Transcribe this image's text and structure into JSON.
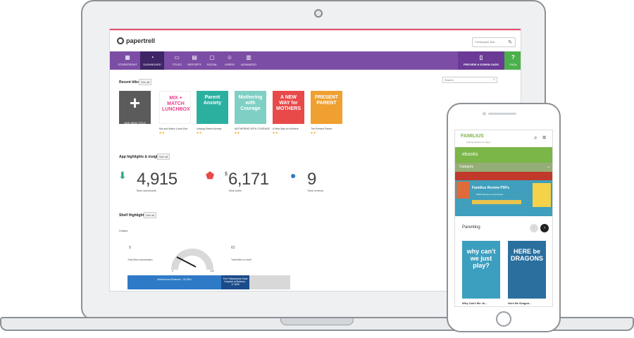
{
  "app": {
    "logo_text": "papertrell",
    "user_name": "Christopher Bat...",
    "attach_icon": "paperclip-icon"
  },
  "nav": {
    "items": [
      {
        "label": "STOREFRONT",
        "icon": "store-icon"
      },
      {
        "label": "DASHBOARD",
        "icon": "dashboard-icon",
        "active": true
      },
      {
        "label": "TITLES",
        "icon": "book-icon"
      },
      {
        "label": "REPORTS",
        "icon": "report-icon"
      },
      {
        "label": "SOCIAL",
        "icon": "chat-icon"
      },
      {
        "label": "USERS",
        "icon": "users-icon"
      },
      {
        "label": "ADVANCED",
        "icon": "settings-icon"
      }
    ],
    "preview_label": "PREVIEW & DOWNLOADS",
    "help_label": "FAQs",
    "help_icon": "?"
  },
  "recent": {
    "heading": "Recent titles",
    "see_all": "See all",
    "search_placeholder": "Search",
    "add_label": "ADD NEW TITLE",
    "books": [
      {
        "title": "MIX + MATCH LUNCHBOX",
        "caption": "Mix and Match Lunch Box",
        "color": "#ffffff",
        "text_color": "#e83e8c"
      },
      {
        "title": "Parent Anxiety",
        "caption": "Untying Parent Anxiety",
        "color": "#2bb0a0",
        "text_color": "#ffffff"
      },
      {
        "title": "Mothering with Courage",
        "caption": "MOTHERING WITH COURAGE",
        "color": "#7fcfc4",
        "text_color": "#ffffff"
      },
      {
        "title": "A NEW WAY for MOTHERS",
        "caption": "A New Way for Mothers",
        "color": "#e84a4a",
        "text_color": "#ffffff"
      },
      {
        "title": "PRESENT PARENT",
        "caption": "The Present Parent",
        "color": "#f0a030",
        "text_color": "#ffffff"
      }
    ]
  },
  "insights": {
    "heading": "App highlights & insights",
    "see_all": "See all",
    "stats": [
      {
        "value": "4,915",
        "label": "Total downloads",
        "icon": "download-icon",
        "color": "#2ea58a"
      },
      {
        "value": "6,171",
        "label": "Total sales",
        "icon": "price-tag-icon",
        "color": "#e84a4a",
        "currency": "$"
      },
      {
        "value": "9",
        "label": "Total reviews",
        "icon": "chat-bubbles-icon",
        "color": "#2e7ac7"
      }
    ]
  },
  "shelf": {
    "heading": "Shelf Highlights",
    "see_all": "See all",
    "panel_title": "Costco",
    "left_value": "9",
    "left_label": "Total titles downloaded",
    "right_value": "62",
    "right_label": "Total titles on shelf",
    "gauge_min": "0",
    "gauge_max": "100",
    "bar_blue_label": "Motherhood Realized - 33.28%",
    "bar_navy_label": "The Philadelphia State Hospital at Byberry - 17.85%"
  },
  "phone": {
    "brand": "FAMILIUS",
    "tagline": "Helping families be happy",
    "section_bar": "ebooks",
    "category_label": "Category",
    "banner_title": "Familius Review PDFs",
    "banner_sub": "100% discount on all ebooks",
    "row_title": "Parenting",
    "books": [
      {
        "title": "why can't we just play?",
        "caption": "Why Can't We Ju...",
        "color": "#3d9fbf"
      },
      {
        "title": "HERE be DRAGONS",
        "caption": "Here Be Dragon...",
        "color": "#2a6f9e"
      }
    ]
  }
}
